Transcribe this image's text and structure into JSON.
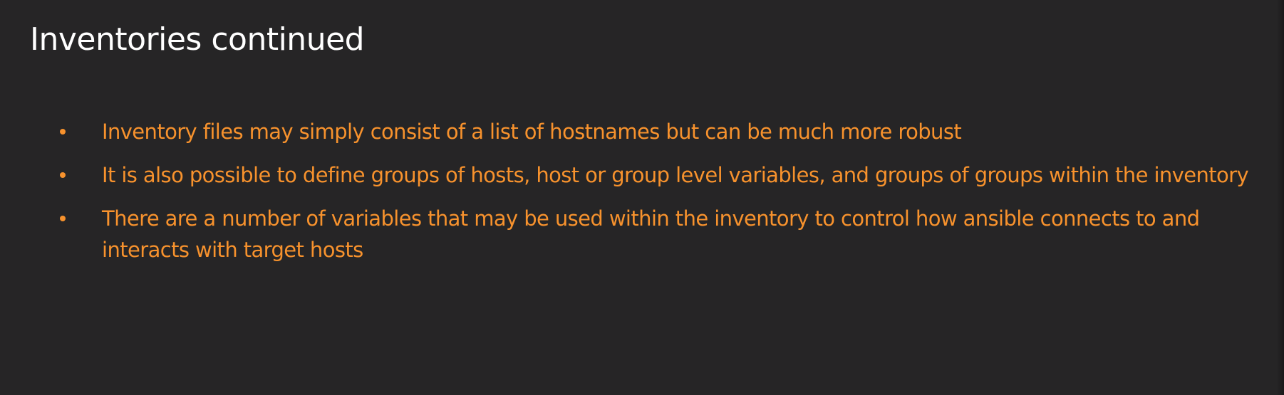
{
  "slide": {
    "title": "Inventories continued",
    "bullets": [
      "Inventory files may simply consist of a list of hostnames but can be much more robust",
      "It is also possible to define groups of hosts, host or group level variables, and groups of groups within the inventory",
      "There are a number of variables that may be used within the inventory to control how ansible connects to and interacts with target hosts"
    ]
  },
  "colors": {
    "background": "#262526",
    "title": "#ffffff",
    "accent": "#f7922d"
  }
}
